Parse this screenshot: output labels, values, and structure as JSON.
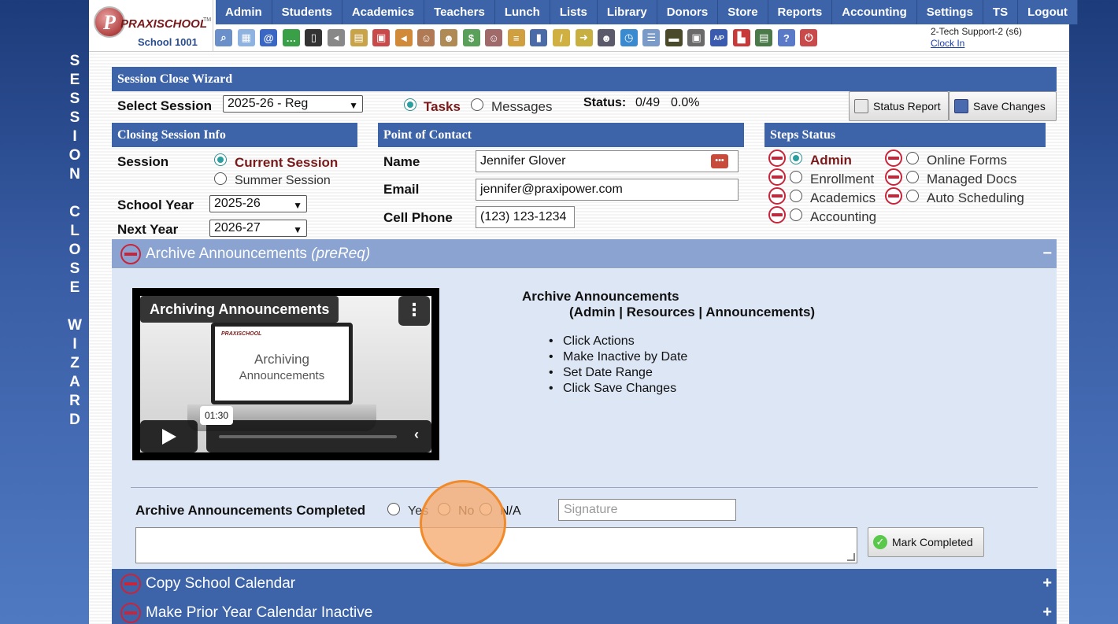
{
  "side_title": "SESSION CLOSE WIZARD",
  "side_title_letters": "S\nE\nS\nS\nI\nO\nN\n \nC\nL\nO\nS\nE\n \nW\nI\nZ\nA\nR\nD",
  "brand": {
    "logo_letter": "P",
    "logo_text": "PRAXISCHOOL",
    "tm": "TM",
    "school": "School 1001"
  },
  "nav": [
    "Admin",
    "Students",
    "Academics",
    "Teachers",
    "Lunch",
    "Lists",
    "Library",
    "Donors",
    "Store",
    "Reports",
    "Accounting",
    "Settings",
    "TS",
    "Logout"
  ],
  "toolbar_icons": [
    {
      "name": "search-icon",
      "color": "#6a8fc9",
      "glyph": "⌕"
    },
    {
      "name": "grid-icon",
      "color": "#8fb3e0",
      "glyph": "▦"
    },
    {
      "name": "email-icon",
      "color": "#3a66c4",
      "glyph": "@"
    },
    {
      "name": "chat-icon",
      "color": "#3aa048",
      "glyph": "…"
    },
    {
      "name": "phone-icon",
      "color": "#333333",
      "glyph": "▯"
    },
    {
      "name": "speaker-icon",
      "color": "#888888",
      "glyph": "◂"
    },
    {
      "name": "form-icon",
      "color": "#c9a34a",
      "glyph": "▤"
    },
    {
      "name": "calendar-icon",
      "color": "#c94a4a",
      "glyph": "▣"
    },
    {
      "name": "megaphone-icon",
      "color": "#d08a3a",
      "glyph": "◄"
    },
    {
      "name": "add-user-icon",
      "color": "#b07a55",
      "glyph": "☺"
    },
    {
      "name": "user-icon",
      "color": "#b08a55",
      "glyph": "☻"
    },
    {
      "name": "money-icon",
      "color": "#5aa05a",
      "glyph": "$"
    },
    {
      "name": "people-icon",
      "color": "#a06a6a",
      "glyph": "☺"
    },
    {
      "name": "burger-icon",
      "color": "#d0a040",
      "glyph": "≡"
    },
    {
      "name": "book-icon",
      "color": "#4a6aa8",
      "glyph": "▮"
    },
    {
      "name": "broom-icon",
      "color": "#d0b040",
      "glyph": "/"
    },
    {
      "name": "arrow-icon",
      "color": "#c8b040",
      "glyph": "➜"
    },
    {
      "name": "teacher-icon",
      "color": "#5a5a6a",
      "glyph": "☻"
    },
    {
      "name": "clock-icon",
      "color": "#3a8ad0",
      "glyph": "◷"
    },
    {
      "name": "list-icon",
      "color": "#7a9ac8",
      "glyph": "☰"
    },
    {
      "name": "card-icon",
      "color": "#4a4a2a",
      "glyph": "▬"
    },
    {
      "name": "printer-icon",
      "color": "#6a6a6a",
      "glyph": "▣"
    },
    {
      "name": "ap-icon",
      "color": "#3a5ab0",
      "glyph": "A/P"
    },
    {
      "name": "pdf-icon",
      "color": "#c83a3a",
      "glyph": "▙"
    },
    {
      "name": "register-icon",
      "color": "#4a7a4a",
      "glyph": "▤"
    },
    {
      "name": "help-icon",
      "color": "#5a7ac8",
      "glyph": "?"
    },
    {
      "name": "power-icon",
      "color": "#c84a4a",
      "glyph": "⏻"
    }
  ],
  "user": {
    "line1": "2-Tech Support-2 (s6)",
    "clock_in": "Clock In"
  },
  "wizard": {
    "title": "Session Close Wizard",
    "select_session_label": "Select Session",
    "session_value": "2025-26 - Reg",
    "tasks_label": "Tasks",
    "messages_label": "Messages",
    "status_label": "Status:",
    "status_value": "0/49",
    "status_pct": "0.0%",
    "status_report_btn": "Status Report",
    "save_changes_btn": "Save Changes"
  },
  "closing": {
    "title": "Closing Session Info",
    "session_label": "Session",
    "current_session": "Current Session",
    "summer_session": "Summer Session",
    "school_year_label": "School Year",
    "school_year_value": "2025-26",
    "next_year_label": "Next Year",
    "next_year_value": "2026-27"
  },
  "contact": {
    "title": "Point of Contact",
    "name_label": "Name",
    "name_value": "Jennifer Glover",
    "email_label": "Email",
    "email_value": "jennifer@praxipower.com",
    "cell_label": "Cell Phone",
    "cell_value": "(123) 123-1234"
  },
  "steps": {
    "title": "Steps Status",
    "col1": [
      "Admin",
      "Enrollment",
      "Academics",
      "Accounting"
    ],
    "col2": [
      "Online Forms",
      "Managed Docs",
      "Auto Scheduling"
    ]
  },
  "archive": {
    "title": "Archive Announcements",
    "prereq": "(preReq)",
    "toggle": "−",
    "video_title": "Archiving Announcements",
    "video_brand": "PRAXISCHOOL",
    "video_screen_line1": "Archiving",
    "video_screen_line2": "Announcements",
    "video_menu": "⋮",
    "video_time": "01:30",
    "instr_title": "Archive Announcements",
    "instr_path": "(Admin | Resources | Announcements)",
    "instr_steps": [
      "Click Actions",
      "Make Inactive by Date",
      "Set Date Range",
      "Click Save Changes"
    ],
    "completed_label": "Archive Announcements Completed",
    "yes": "Yes",
    "no": "No",
    "na": "N/A",
    "signature_placeholder": "Signature",
    "mark_completed_btn": "Mark Completed"
  },
  "collapsed_sections": [
    {
      "title": "Copy School Calendar",
      "toggle": "+"
    },
    {
      "title": "Make Prior Year Calendar Inactive",
      "toggle": "+"
    }
  ],
  "colors": {
    "header_blue": "#3d64a8",
    "accent_red": "#c8243a",
    "active_radio": "#2a9fa0",
    "highlight_orange": "#f08a2a"
  }
}
